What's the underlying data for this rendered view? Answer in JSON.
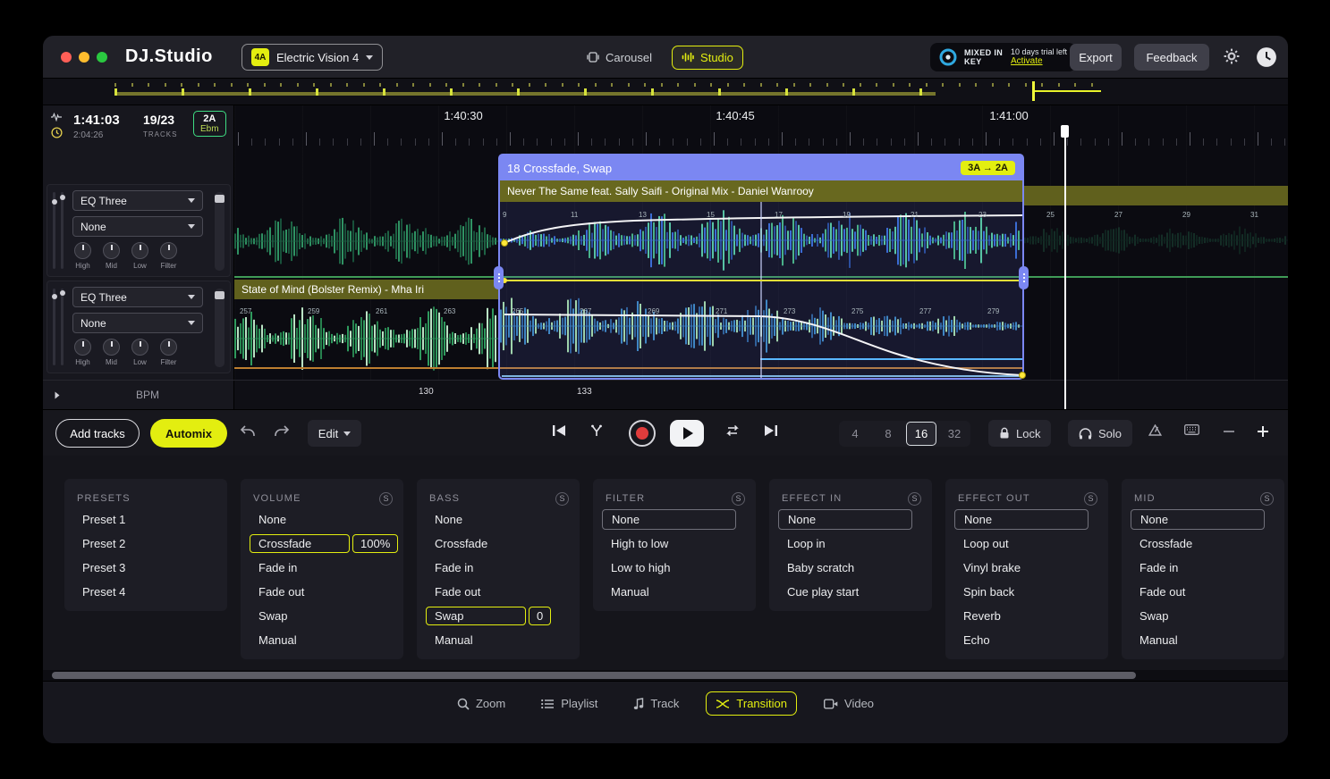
{
  "colors": {
    "accent": "#e3ee10",
    "crossfade_blue": "#7b87f2",
    "track_bar_olive": "#60601d",
    "key_green": "#3edc83",
    "record_red": "#e03c3c",
    "traffic_lights": [
      "#ff5f57",
      "#febc2e",
      "#2ac840"
    ]
  },
  "header": {
    "logo": "DJ.Studio",
    "mix_selector": {
      "key_badge": "4A",
      "label": "Electric Vision 4"
    },
    "view_toggle": {
      "carousel": "Carousel",
      "studio": "Studio"
    },
    "mixedinkey": {
      "brand": "MIXED IN KEY",
      "trial_text": "10 days trial left",
      "activate_label": "Activate"
    },
    "export_label": "Export",
    "feedback_label": "Feedback"
  },
  "status_bar": {
    "current_time": "1:41:03",
    "total_time": "2:04:26",
    "track_count": "19/23",
    "track_count_label": "TRACKS",
    "key_code": "2A",
    "key_name": "Ebm"
  },
  "decks": [
    {
      "eq_preset": "EQ Three",
      "effect": "None",
      "knobs": [
        "High",
        "Mid",
        "Low",
        "Filter"
      ]
    },
    {
      "eq_preset": "EQ Three",
      "effect": "None",
      "knobs": [
        "High",
        "Mid",
        "Low",
        "Filter"
      ]
    }
  ],
  "timeline": {
    "ruler_labels": [
      "1:40:30",
      "1:40:45",
      "1:41:00"
    ],
    "bpm_label": "BPM",
    "bpm_markers": [
      "130",
      "133"
    ],
    "lane_a_beats": [
      "9",
      "11",
      "13",
      "15",
      "17",
      "19",
      "21",
      "23",
      "25",
      "27",
      "29",
      "31"
    ],
    "lane_b_beats": [
      "257",
      "259",
      "261",
      "263",
      "265",
      "267",
      "269",
      "271",
      "273",
      "275",
      "277",
      "279"
    ],
    "track_a_title": "Never The Same feat. Sally Saifi - Original Mix - Daniel Wanrooy",
    "track_b_title": "State of Mind (Bolster Remix) - Mha Iri",
    "crossfade_title": "18 Crossfade, Swap",
    "crossfade_keys": "3A → 2A"
  },
  "toolbar": {
    "add_tracks_label": "Add tracks",
    "automix_label": "Automix",
    "edit_label": "Edit",
    "grid_options": [
      "4",
      "8",
      "16",
      "32"
    ],
    "grid_selected": "16",
    "lock_label": "Lock",
    "solo_label": "Solo"
  },
  "s_badge_label": "S",
  "transition_panels": [
    {
      "title": "PRESETS",
      "s_badge": false,
      "rows": [
        {
          "type": "item",
          "label": "Preset 1"
        },
        {
          "type": "item",
          "label": "Preset 2"
        },
        {
          "type": "item",
          "label": "Preset 3"
        },
        {
          "type": "item",
          "label": "Preset 4"
        }
      ]
    },
    {
      "title": "VOLUME",
      "s_badge": true,
      "rows": [
        {
          "type": "item",
          "label": "None"
        },
        {
          "type": "selected",
          "label": "Crossfade",
          "value": "100%"
        },
        {
          "type": "item",
          "label": "Fade in"
        },
        {
          "type": "item",
          "label": "Fade out"
        },
        {
          "type": "item",
          "label": "Swap"
        },
        {
          "type": "item",
          "label": "Manual"
        }
      ]
    },
    {
      "title": "BASS",
      "s_badge": true,
      "rows": [
        {
          "type": "item",
          "label": "None"
        },
        {
          "type": "item",
          "label": "Crossfade"
        },
        {
          "type": "item",
          "label": "Fade in"
        },
        {
          "type": "item",
          "label": "Fade out"
        },
        {
          "type": "selected",
          "label": "Swap",
          "value": "0"
        },
        {
          "type": "item",
          "label": "Manual"
        }
      ]
    },
    {
      "title": "FILTER",
      "s_badge": true,
      "rows": [
        {
          "type": "select",
          "label": "None"
        },
        {
          "type": "item",
          "label": "High to low"
        },
        {
          "type": "item",
          "label": "Low to high"
        },
        {
          "type": "item",
          "label": "Manual"
        }
      ]
    },
    {
      "title": "EFFECT IN",
      "s_badge": true,
      "rows": [
        {
          "type": "select",
          "label": "None"
        },
        {
          "type": "item",
          "label": "Loop in"
        },
        {
          "type": "item",
          "label": "Baby scratch"
        },
        {
          "type": "item",
          "label": "Cue play start"
        }
      ]
    },
    {
      "title": "EFFECT OUT",
      "s_badge": true,
      "rows": [
        {
          "type": "select",
          "label": "None"
        },
        {
          "type": "item",
          "label": "Loop out"
        },
        {
          "type": "item",
          "label": "Vinyl brake"
        },
        {
          "type": "item",
          "label": "Spin back"
        },
        {
          "type": "item",
          "label": "Reverb"
        },
        {
          "type": "item",
          "label": "Echo"
        }
      ]
    },
    {
      "title": "MID",
      "s_badge": true,
      "rows": [
        {
          "type": "select",
          "label": "None"
        },
        {
          "type": "item",
          "label": "Crossfade"
        },
        {
          "type": "item",
          "label": "Fade in"
        },
        {
          "type": "item",
          "label": "Fade out"
        },
        {
          "type": "item",
          "label": "Swap"
        },
        {
          "type": "item",
          "label": "Manual"
        }
      ]
    }
  ],
  "bottom_tabs": [
    {
      "label": "Zoom",
      "icon": "zoom",
      "active": false
    },
    {
      "label": "Playlist",
      "icon": "playlist",
      "active": false
    },
    {
      "label": "Track",
      "icon": "track-note",
      "active": false
    },
    {
      "label": "Transition",
      "icon": "transition",
      "active": true
    },
    {
      "label": "Video",
      "icon": "video",
      "active": false
    }
  ]
}
